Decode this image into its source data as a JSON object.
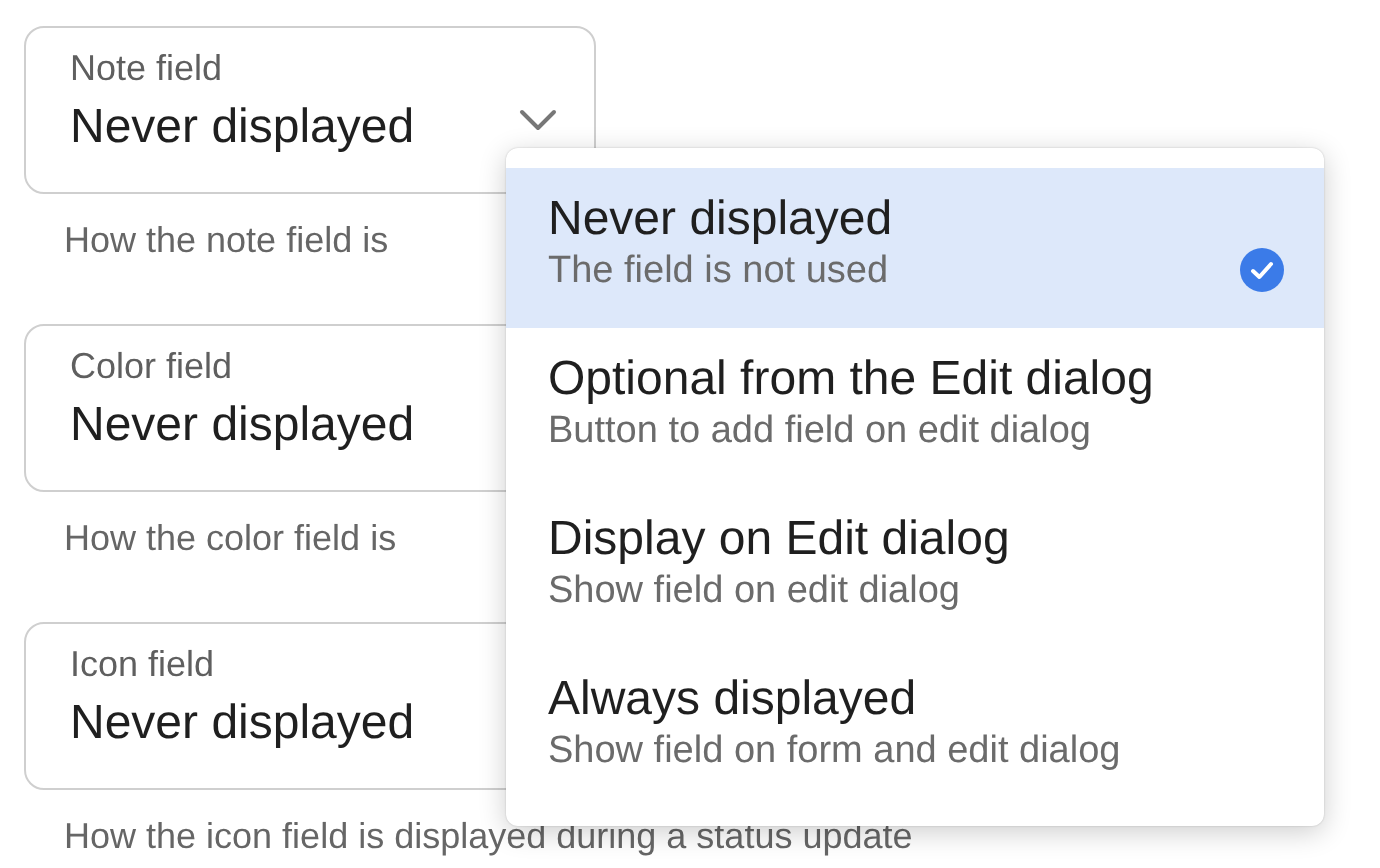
{
  "fields": [
    {
      "label": "Note field",
      "value": "Never displayed",
      "helper": "How the note field is",
      "menu": {
        "options": [
          {
            "title": "Never displayed",
            "subtitle": "The field is not used",
            "selected": true
          },
          {
            "title": "Optional from the Edit dialog",
            "subtitle": "Button to add field on edit dialog",
            "selected": false
          },
          {
            "title": "Display on Edit dialog",
            "subtitle": "Show field on edit dialog",
            "selected": false
          },
          {
            "title": "Always displayed",
            "subtitle": "Show field on form and edit dialog",
            "selected": false
          }
        ]
      }
    },
    {
      "label": "Color field",
      "value": "Never displayed",
      "helper": "How the color field is"
    },
    {
      "label": "Icon field",
      "value": "Never displayed",
      "helper": "How the icon field is displayed during a status update"
    }
  ]
}
